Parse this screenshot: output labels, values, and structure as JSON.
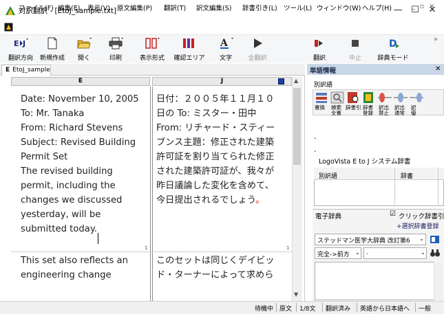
{
  "window": {
    "title": "対訳翻訳 - [EtoJ_sample.txt]",
    "min_glyph": "—",
    "max_glyph": "☐",
    "close_glyph": "✕"
  },
  "menu": {
    "items": [
      "ファイル(F)",
      "編集(E)",
      "表示(V)",
      "原文編集(P)",
      "翻訳(T)",
      "訳文編集(S)",
      "辞書引き(L)",
      "ツール(L)",
      "ウィンドウ(W)",
      "ヘルプ(H)"
    ],
    "mdi_controls": "_ ▫ ×"
  },
  "toolbar": {
    "buttons": [
      {
        "label": "翻訳方向",
        "icon": "E▸J"
      },
      {
        "label": "新規作成",
        "icon": "new-doc"
      },
      {
        "label": "開く",
        "icon": "open-folder"
      },
      {
        "label": "印刷",
        "icon": "printer"
      },
      {
        "label": "表示形式",
        "icon": "layout"
      },
      {
        "label": "確認エリア",
        "icon": "columns"
      },
      {
        "label": "文字",
        "icon": "A"
      },
      {
        "label": "全翻訳",
        "icon": "play"
      },
      {
        "label": "翻訳",
        "icon": "translate"
      },
      {
        "label": "中止",
        "icon": "stop"
      },
      {
        "label": "辞典モード",
        "icon": "D"
      }
    ],
    "overflow": "»"
  },
  "document": {
    "tab_label": "EtoJ_sample.t",
    "tab_marker": "E",
    "col_e": "E",
    "col_j": "J",
    "english_lines": [
      "Date: November 10, 2005",
      "To: Mr. Tanaka",
      "From: Richard Stevens",
      "Subject: Revised Building",
      "Permit Set",
      "The revised building",
      "permit, including the",
      "changes we discussed",
      "yesterday, will be",
      "submitted today."
    ],
    "japanese_lines": [
      "日付：２００５年１１月１０",
      "日の To: ミスター・田中",
      "From: リチャード・スティー",
      "ブンス主題：修正された建築",
      "許可証を割り当てられた修正",
      "された建築許可証が、我々が",
      "昨日議論した変化を含めて、",
      "今日提出されるでしょう。"
    ],
    "para_no_1": "1",
    "para_no_2": "1",
    "english_lines_2": [
      "This set also reflects an",
      "engineering change"
    ],
    "japanese_lines_2": [
      "このセットは同じくデイビッ",
      "ド・ターナーによって求めら"
    ]
  },
  "side": {
    "title": "単語情報",
    "close": "✕",
    "alt_words": "別訳語",
    "icon_labels": [
      "置換",
      "検索\n全置",
      "辞書引",
      "辞書\n登録",
      "訳出\n禁止",
      "訳出\n通常",
      "訳\n優"
    ],
    "bullet1": "·",
    "bullet2": "·",
    "dict_name": "LogoVista E to J システム辞書",
    "table_head_word": "別訳語",
    "table_head_dict": "辞書",
    "edict_title": "電子辞典",
    "click_lookup": "クリック辞書引",
    "click_checked": "☑",
    "register": "+選択辞書登録",
    "dict_select": "ステッドマン医学大辞典 改訂第6",
    "match_select": "完全->前方",
    "search_value": "."
  },
  "status": {
    "items": [
      "待機中",
      "原文",
      "1/8文",
      "翻訳済み",
      "英語から日本語へ",
      "一般"
    ]
  },
  "colors": {
    "side_title_bg": "#c9d6e6",
    "accent_blue": "#1c5fbe",
    "accent_red": "#d02020"
  }
}
